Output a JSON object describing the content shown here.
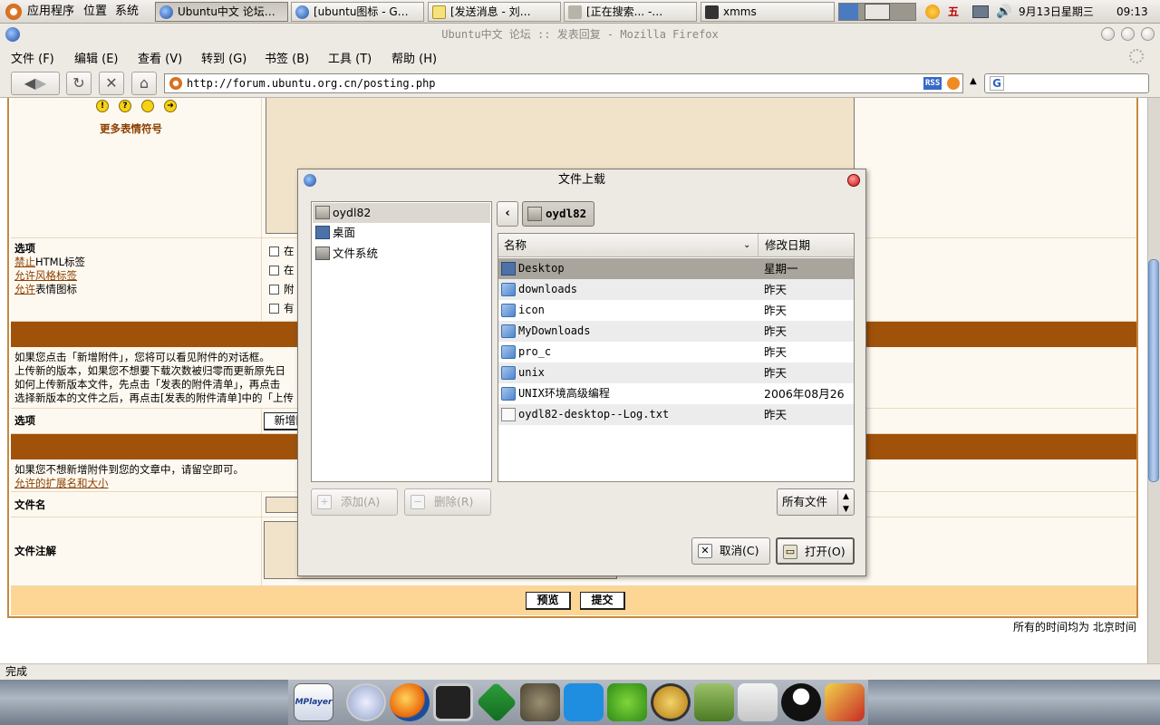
{
  "top_panel": {
    "menus": [
      "应用程序",
      "位置",
      "系统"
    ],
    "tasks": [
      {
        "label": "Ubuntu中文 论坛…",
        "active": true,
        "icon": "firefox-icon"
      },
      {
        "label": "[ubuntu图标 - G…",
        "active": false,
        "icon": "firefox-icon"
      },
      {
        "label": "[发送消息 - 刘…",
        "active": false,
        "icon": "note-icon"
      },
      {
        "label": "[正在搜索... -…",
        "active": false,
        "icon": "search-icon"
      },
      {
        "label": "xmms",
        "active": false,
        "icon": "xmms-icon"
      }
    ],
    "tray": {
      "weekday_glyph": "五",
      "date": "9月13日星期三",
      "time": "09:13"
    }
  },
  "browser": {
    "title": "Ubuntu中文 论坛 :: 发表回复 - Mozilla Firefox",
    "menus": [
      "文件 (F)",
      "编辑 (E)",
      "查看 (V)",
      "转到 (G)",
      "书签 (B)",
      "工具 (T)",
      "帮助 (H)"
    ],
    "url": "http://forum.ubuntu.org.cn/posting.php",
    "rss_label": "RSS",
    "status": "完成"
  },
  "page": {
    "more_smilies": "更多表情符号",
    "options_heading": "选项",
    "option_links": [
      {
        "link": "禁止",
        "rest": "HTML标签"
      },
      {
        "link": "允许",
        "rest": "风格标签"
      },
      {
        "link": "允许",
        "rest": "表情图标"
      }
    ],
    "option_checks": [
      "在",
      "在",
      "附",
      "有"
    ],
    "attach_info": [
      "如果您点击「新增附件」，您将可以看见附件的对话框。",
      "上传新的版本，如果您不想要下载次数被归零而更新原先日",
      "如何上传新版本文件，先点击「发表的附件清单」，再点击",
      "选择新版本的文件之后，再点击[发表的附件清单]中的「上传"
    ],
    "options_label2": "选项",
    "new_attach_btn": "新增附",
    "no_attach_note": "如果您不想新增附件到您的文章中，请留空即可。",
    "ext_link": "允许的扩展名和大小",
    "filename_label": "文件名",
    "comment_label": "文件注解",
    "preview_btn": "预览",
    "submit_btn": "提交",
    "timezone_note": "所有的时间均为 北京时间"
  },
  "dialog": {
    "title": "文件上载",
    "places": [
      {
        "label": "oydl82",
        "icon": "home-icon",
        "selected": true
      },
      {
        "label": "桌面",
        "icon": "desktop-icon",
        "selected": false
      },
      {
        "label": "文件系统",
        "icon": "drive-icon",
        "selected": false
      }
    ],
    "path_button": "oydl82",
    "columns": {
      "name": "名称",
      "modified": "修改日期"
    },
    "files": [
      {
        "name": "Desktop",
        "date": "星期一",
        "type": "desktop",
        "selected": true
      },
      {
        "name": "downloads",
        "date": "昨天",
        "type": "folder",
        "selected": false
      },
      {
        "name": "icon",
        "date": "昨天",
        "type": "folder",
        "selected": false
      },
      {
        "name": "MyDownloads",
        "date": "昨天",
        "type": "folder",
        "selected": false
      },
      {
        "name": "pro_c",
        "date": "昨天",
        "type": "folder",
        "selected": false
      },
      {
        "name": "unix",
        "date": "昨天",
        "type": "folder",
        "selected": false
      },
      {
        "name": "UNIX环境高级编程",
        "date": "2006年08月26日",
        "type": "folder",
        "selected": false
      },
      {
        "name": "oydl82-desktop--Log.txt",
        "date": "昨天",
        "type": "file",
        "selected": false
      }
    ],
    "add_btn": "添加(A)",
    "remove_btn": "删除(R)",
    "filter": "所有文件",
    "cancel_btn": "取消(C)",
    "open_btn": "打开(O)"
  },
  "dock_apps": [
    "mplayer-icon",
    "itunes-icon",
    "firefox-icon",
    "terminal-icon",
    "vim-icon",
    "gimp-icon",
    "dreamweaver-icon",
    "network-icon",
    "mail-icon",
    "books-icon",
    "editor-icon",
    "qq-icon",
    "dx-icon"
  ],
  "dock_labels": {
    "mplayer": "MPlayer"
  }
}
